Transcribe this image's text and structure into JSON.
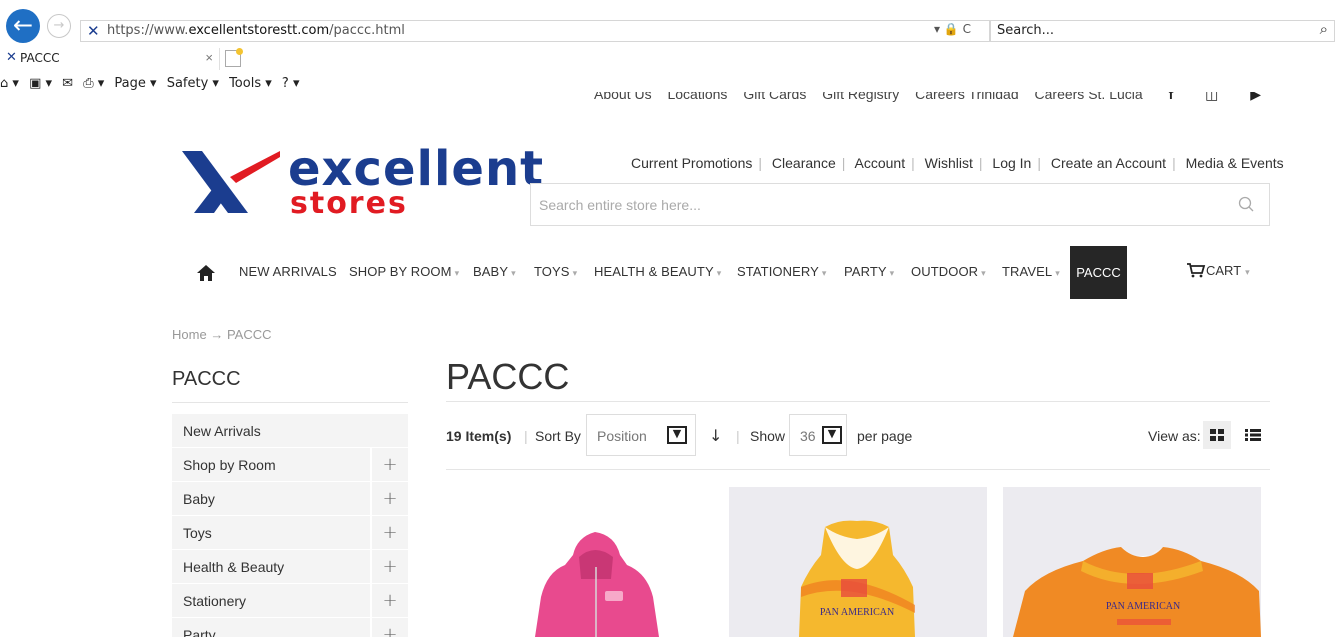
{
  "browser": {
    "url_prefix": "https://www.",
    "url_domain": "excellentstorestt.com",
    "url_path": "/paccc.html",
    "addr_icons": "▾ 🔒 C",
    "search_placeholder": "Search...",
    "tab_title": "PACCC",
    "command_bar": {
      "page": "Page ▾",
      "safety": "Safety ▾",
      "tools": "Tools ▾"
    }
  },
  "top_links": [
    "About Us",
    "Locations",
    "Gift Cards",
    "Gift Registry",
    "Careers Trinidad",
    "Careers St. Lucia"
  ],
  "logo": {
    "word1": "excellent",
    "word2": "stores"
  },
  "header_links": [
    "Current Promotions",
    "Clearance",
    "Account",
    "Wishlist",
    "Log In",
    "Create an Account",
    "Media & Events"
  ],
  "store_search": {
    "placeholder": "Search entire store here..."
  },
  "nav": {
    "items": [
      {
        "label": "NEW ARRIVALS",
        "caret": false
      },
      {
        "label": "SHOP BY ROOM",
        "caret": true
      },
      {
        "label": "BABY",
        "caret": true
      },
      {
        "label": "TOYS",
        "caret": true
      },
      {
        "label": "HEALTH & BEAUTY",
        "caret": true
      },
      {
        "label": "STATIONERY",
        "caret": true
      },
      {
        "label": "PARTY",
        "caret": true
      },
      {
        "label": "OUTDOOR",
        "caret": true
      },
      {
        "label": "TRAVEL",
        "caret": true
      }
    ],
    "active": "PACCC",
    "cart": "CART"
  },
  "breadcrumb": {
    "home": "Home",
    "arrow": "→",
    "current": "PACCC"
  },
  "sidebar": {
    "title": "PACCC",
    "items": [
      {
        "label": "New Arrivals",
        "expand": ""
      },
      {
        "label": "Shop by Room",
        "expand": "+"
      },
      {
        "label": "Baby",
        "expand": "+"
      },
      {
        "label": "Toys",
        "expand": "+"
      },
      {
        "label": "Health & Beauty",
        "expand": "+"
      },
      {
        "label": "Stationery",
        "expand": "+"
      },
      {
        "label": "Party",
        "expand": "+"
      }
    ]
  },
  "main": {
    "title": "PACCC"
  },
  "toolbar": {
    "count": "19 Item(s)",
    "sort_by_label": "Sort By",
    "sort_value": "Position",
    "show_label": "Show",
    "show_value": "36",
    "per_page_label": "per page",
    "view_as_label": "View as:"
  },
  "products": [
    {
      "name": "pink hoodie",
      "color": "#e84a8e"
    },
    {
      "name": "pan american tank top",
      "color": "#f5b82e",
      "print": "PAN AMERICAN"
    },
    {
      "name": "pan american long sleeve",
      "color": "#f08a24",
      "print": "PAN AMERICAN"
    }
  ],
  "colors": {
    "brand_blue": "#1b3d8f",
    "brand_red": "#e11b22",
    "nav_active_bg": "#262626",
    "sidebar_bg": "#f4f4f4"
  }
}
